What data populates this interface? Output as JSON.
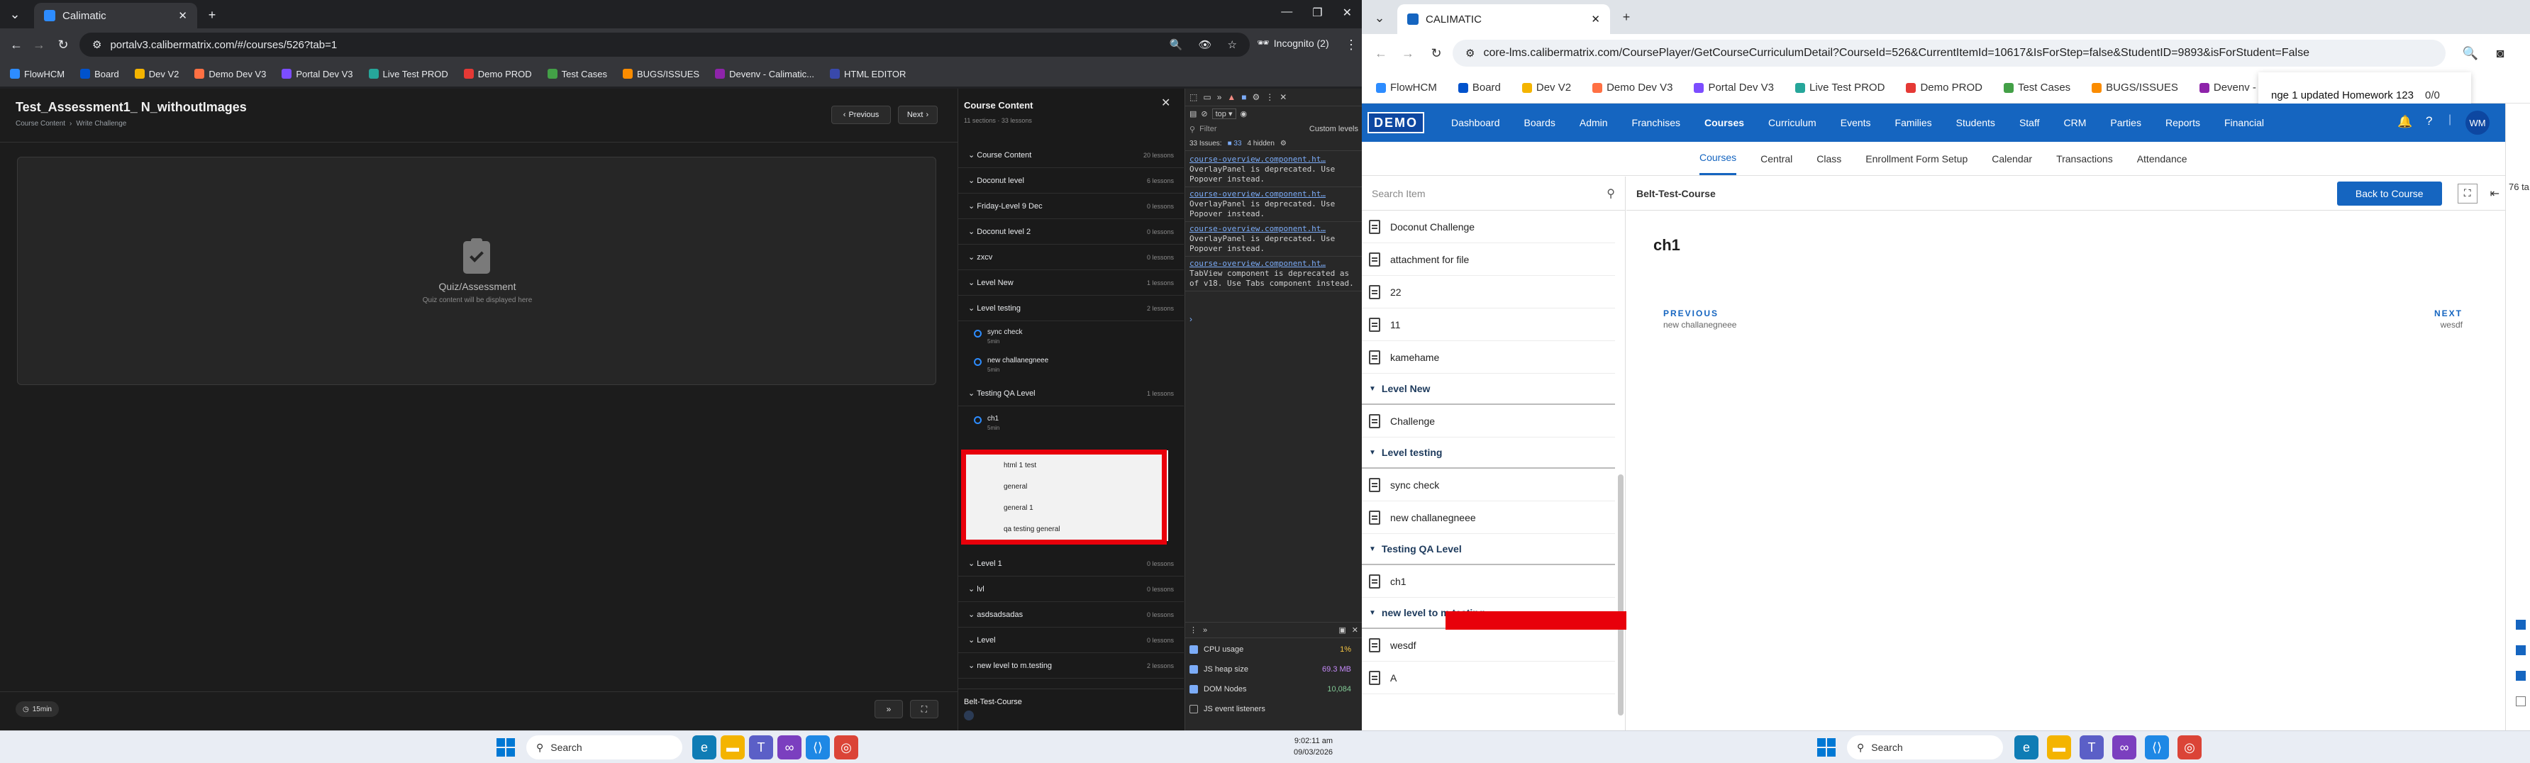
{
  "left_browser": {
    "tab_title": "Calimatic",
    "url": "portalv3.calibermatrix.com/#/courses/526?tab=1",
    "incognito_label": "Incognito (2)",
    "bookmarks": [
      "FlowHCM",
      "Board",
      "Dev V2",
      "Demo Dev V3",
      "Portal Dev V3",
      "Live Test PROD",
      "Demo PROD",
      "Test Cases",
      "BUGS/ISSUES",
      "Devenv - Calimatic...",
      "HTML EDITOR"
    ]
  },
  "left_app": {
    "title": "Test_Assessment1_ N_withoutImages",
    "breadcrumb": [
      "Course Content",
      "Write Challenge"
    ],
    "prev_label": "Previous",
    "next_label": "Next",
    "quiz_title": "Quiz/Assessment",
    "quiz_sub": "Quiz content will be displayed here",
    "time_badge": "15min",
    "course_content_title": "Course Content",
    "course_content_meta": "11 sections · 33 lessons",
    "sections": [
      {
        "name": "Course Content",
        "count": "20 lessons"
      },
      {
        "name": "Doconut level",
        "count": "6 lessons"
      },
      {
        "name": "Friday-Level 9 Dec",
        "count": "0 lessons"
      },
      {
        "name": "Doconut level 2",
        "count": "0 lessons"
      },
      {
        "name": "zxcv",
        "count": "0 lessons"
      },
      {
        "name": "Level New",
        "count": "1 lessons"
      },
      {
        "name": "Level testing",
        "count": "2 lessons"
      }
    ],
    "level_testing_lessons": [
      {
        "name": "sync check",
        "sub": "5min"
      },
      {
        "name": "new challanegneee",
        "sub": "5min"
      }
    ],
    "testing_qa": {
      "name": "Testing QA Level",
      "count": "1 lessons"
    },
    "ch1": {
      "name": "ch1",
      "sub": "5min"
    },
    "highlight_items": [
      "html 1 test",
      "general",
      "general 1",
      "qa testing general"
    ],
    "sections_after": [
      {
        "name": "Level 1",
        "count": "0 lessons"
      },
      {
        "name": "lvl",
        "count": "0 lessons"
      },
      {
        "name": "asdsadsadas",
        "count": "0 lessons"
      },
      {
        "name": "Level",
        "count": "0 lessons"
      },
      {
        "name": "new level to m.testing",
        "count": "2 lessons"
      }
    ],
    "footer_course": "Belt-Test-Course"
  },
  "devtools": {
    "top_label": "top",
    "filter_placeholder": "Filter",
    "levels_label": "Custom levels",
    "issues_label": "33 Issues:",
    "issues_count": "33",
    "hidden_label": "4 hidden",
    "messages": [
      {
        "link": "course-overview.component.ht…",
        "text": "OverlayPanel is deprecated. Use Popover instead."
      },
      {
        "link": "course-overview.component.ht…",
        "text": "OverlayPanel is deprecated. Use Popover instead."
      },
      {
        "link": "course-overview.component.ht…",
        "text": "OverlayPanel is deprecated. Use Popover instead."
      },
      {
        "link": "course-overview.component.ht…",
        "text": "TabView component is deprecated as of v18. Use Tabs component instead."
      }
    ],
    "perf": [
      {
        "label": "CPU usage",
        "value": "1%",
        "color": "#f5c542",
        "checked": true
      },
      {
        "label": "JS heap size",
        "value": "69.3 MB",
        "color": "#c58af9",
        "checked": true
      },
      {
        "label": "DOM Nodes",
        "value": "10,084",
        "color": "#81c995",
        "checked": true
      },
      {
        "label": "JS event listeners",
        "value": "",
        "color": "#dddddd",
        "checked": false
      }
    ]
  },
  "right_browser": {
    "tab_title": "CALIMATIC",
    "url": "core-lms.calibermatrix.com/CoursePlayer/GetCourseCurriculumDetail?CourseId=526&CurrentItemId=10617&IsForStep=false&StudentID=9893&isForStudent=False",
    "bookmarks": [
      "FlowHCM",
      "Board",
      "Dev V2",
      "Demo Dev V3",
      "Portal Dev V3",
      "Live Test PROD",
      "Demo PROD",
      "Test Cases",
      "BUGS/ISSUES",
      "Devenv - Calimatic"
    ],
    "toast": "nge 1 updated Homework 123",
    "toast_count": "0/0"
  },
  "right_app": {
    "logo": "DEMO",
    "nav": [
      "Dashboard",
      "Boards",
      "Admin",
      "Franchises",
      "Courses",
      "Curriculum",
      "Events",
      "Families",
      "Students",
      "Staff",
      "CRM",
      "Parties",
      "Reports",
      "Financial"
    ],
    "avatar": "WM",
    "subnav": [
      "Courses",
      "Central",
      "Class",
      "Enrollment Form Setup",
      "Calendar",
      "Transactions",
      "Attendance"
    ],
    "search_placeholder": "Search Item",
    "course_title": "Belt-Test-Course",
    "back_label": "Back to Course",
    "items_top": [
      "Doconut Challenge",
      "attachment for file",
      "22",
      "11",
      "kamehame"
    ],
    "level_new": "Level New",
    "level_new_items": [
      "Challenge"
    ],
    "level_testing": "Level testing",
    "level_testing_items": [
      "sync check",
      "new challanegneee"
    ],
    "testing_qa": "Testing QA Level",
    "testing_qa_items": [
      "ch1"
    ],
    "new_level": "new level to m.testing",
    "new_level_items": [
      "wesdf",
      "A"
    ],
    "content_title": "ch1",
    "previous_label": "PREVIOUS",
    "previous_sub": "new challanegneee",
    "next_label": "NEXT",
    "next_sub": "wesdf",
    "right_edge_count": "76 ta"
  },
  "taskbar": {
    "search_label": "Search",
    "time": "9:02:11 am",
    "date": "09/03/2026",
    "search_label_right": "Search"
  },
  "colors": {
    "accent_blue": "#1e88e5",
    "nav_blue": "#1565c0",
    "highlight_red": "#e8000b"
  }
}
